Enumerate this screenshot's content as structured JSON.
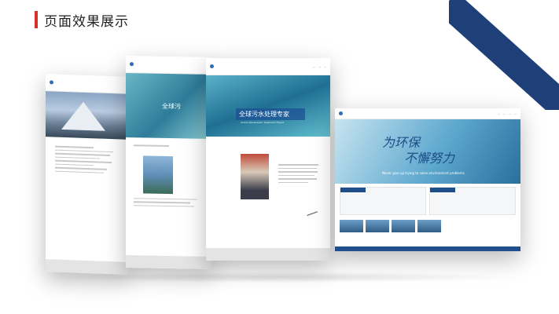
{
  "header": {
    "title": "页面效果展示"
  },
  "mockups": {
    "page3": {
      "hero_title": "全球污水处理专家",
      "hero_subtitle": "Global Wastewater Treatment Expert"
    },
    "page2": {
      "hero_title": "全球污"
    },
    "homepage": {
      "slogan_line1": "为环保",
      "slogan_line2": "不懈努力",
      "slogan_en": "Never give up trying to solve environment problems"
    }
  },
  "colors": {
    "accent_red": "#d6322a",
    "brand_blue": "#1f3f79"
  }
}
